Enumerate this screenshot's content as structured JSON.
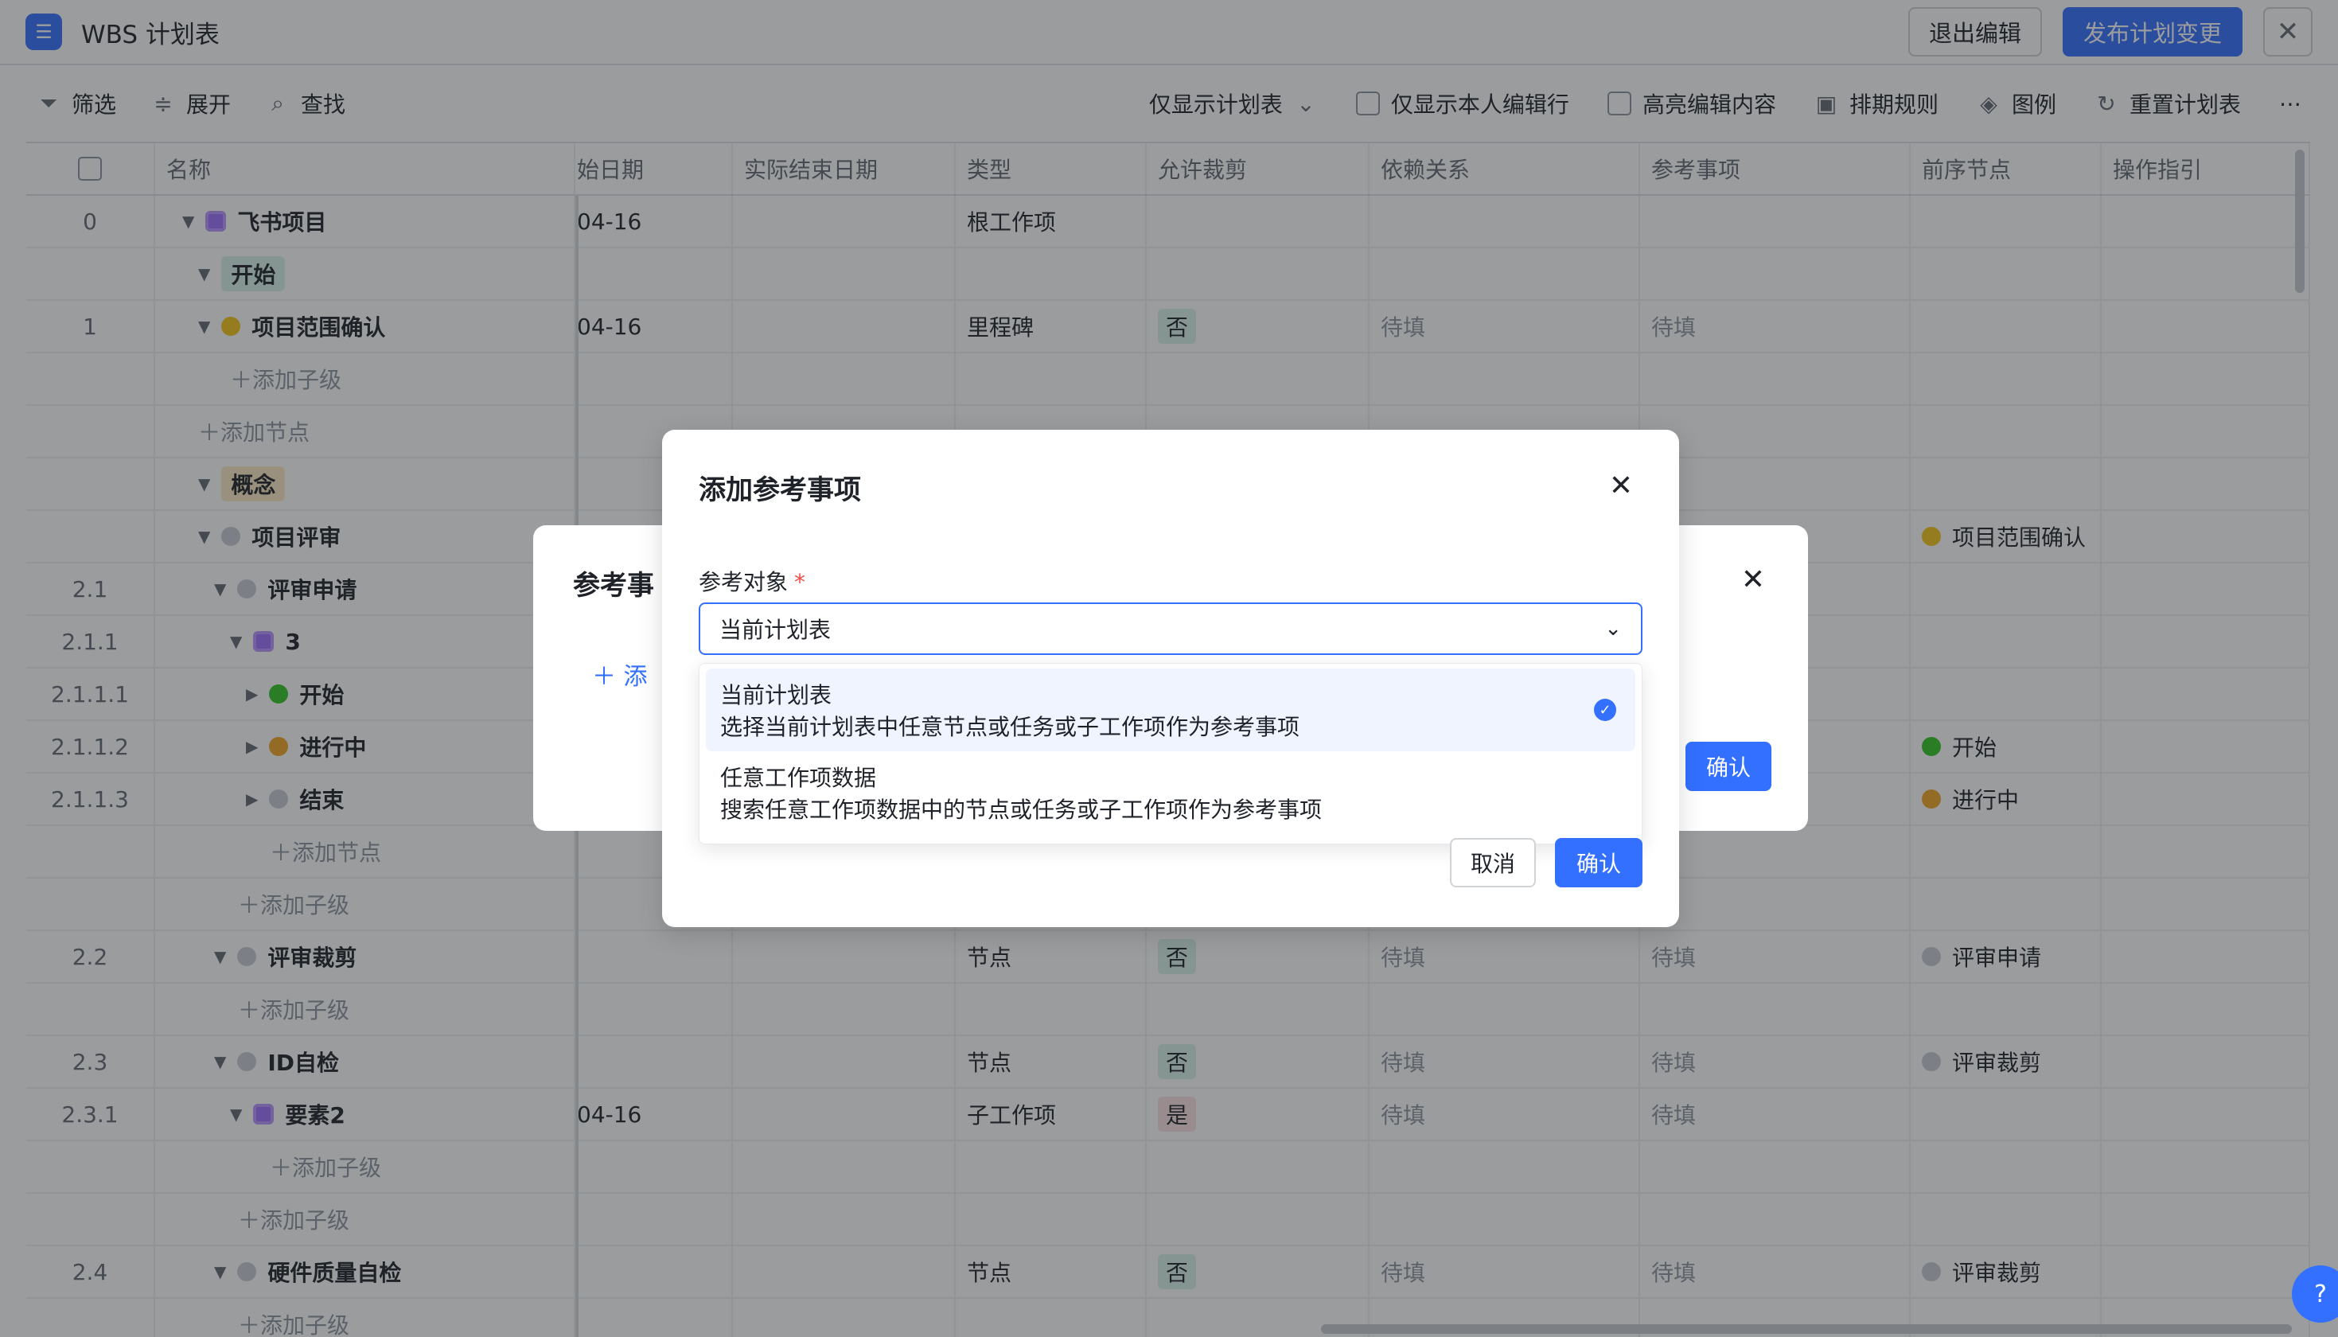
{
  "header": {
    "title": "WBS 计划表",
    "exit_edit": "退出编辑",
    "publish": "发布计划变更"
  },
  "toolbar": {
    "filter": "筛选",
    "expand": "展开",
    "find": "查找",
    "view_select": "仅显示计划表",
    "only_mine": "仅显示本人编辑行",
    "highlight": "高亮编辑内容",
    "schedule_rules": "排期规则",
    "legend": "图例",
    "reset": "重置计划表"
  },
  "table": {
    "headers": [
      "名称",
      "始日期",
      "实际结束日期",
      "类型",
      "允许裁剪",
      "依赖关系",
      "参考事项",
      "前序节点",
      "操作指引"
    ],
    "rows": [
      {
        "num": "0",
        "name": "飞书项目",
        "date": "04-16",
        "type": "根工作项",
        "cut": "",
        "dep": "",
        "ref": "",
        "prev": ""
      },
      {
        "num": "",
        "name": "开始",
        "date": "",
        "type": "",
        "cut": "",
        "dep": "",
        "ref": "",
        "prev": ""
      },
      {
        "num": "1",
        "name": "项目范围确认",
        "date": "04-16",
        "type": "里程碑",
        "cut": "否",
        "dep": "待填",
        "ref": "待填",
        "prev": ""
      },
      {
        "num": "",
        "name": "添加子级",
        "date": "",
        "type": "",
        "cut": "",
        "dep": "",
        "ref": "",
        "prev": ""
      },
      {
        "num": "",
        "name": "添加节点",
        "date": "",
        "type": "",
        "cut": "",
        "dep": "",
        "ref": "",
        "prev": ""
      },
      {
        "num": "",
        "name": "概念",
        "date": "",
        "type": "",
        "cut": "",
        "dep": "",
        "ref": "",
        "prev": ""
      },
      {
        "num": "",
        "name": "项目评审",
        "date": "",
        "type": "",
        "cut": "",
        "dep": "",
        "ref": "",
        "prev": "项目范围确认"
      },
      {
        "num": "2.1",
        "name": "评审申请",
        "date": "",
        "type": "",
        "cut": "",
        "dep": "",
        "ref": "",
        "prev": ""
      },
      {
        "num": "2.1.1",
        "name": "3",
        "date": "",
        "type": "",
        "cut": "",
        "dep": "",
        "ref": "",
        "prev": ""
      },
      {
        "num": "2.1.1.1",
        "name": "开始",
        "date": "",
        "type": "",
        "cut": "",
        "dep": "",
        "ref": "",
        "prev": ""
      },
      {
        "num": "2.1.1.2",
        "name": "进行中",
        "date": "",
        "type": "",
        "cut": "",
        "dep": "",
        "ref": "",
        "prev": "开始"
      },
      {
        "num": "2.1.1.3",
        "name": "结束",
        "date": "",
        "type": "",
        "cut": "",
        "dep": "",
        "ref": "",
        "prev": "进行中"
      },
      {
        "num": "",
        "name": "添加节点",
        "date": "",
        "type": "",
        "cut": "",
        "dep": "",
        "ref": "",
        "prev": ""
      },
      {
        "num": "",
        "name": "添加子级",
        "date": "",
        "type": "",
        "cut": "",
        "dep": "",
        "ref": "",
        "prev": ""
      },
      {
        "num": "2.2",
        "name": "评审裁剪",
        "date": "",
        "type": "节点",
        "cut": "否",
        "dep": "待填",
        "ref": "待填",
        "prev": "评审申请"
      },
      {
        "num": "",
        "name": "添加子级",
        "date": "",
        "type": "",
        "cut": "",
        "dep": "",
        "ref": "",
        "prev": ""
      },
      {
        "num": "2.3",
        "name": "ID自检",
        "date": "",
        "type": "节点",
        "cut": "否",
        "dep": "待填",
        "ref": "待填",
        "prev": "评审裁剪"
      },
      {
        "num": "2.3.1",
        "name": "要素2",
        "date": "04-16",
        "type": "子工作项",
        "cut": "是",
        "dep": "待填",
        "ref": "待填",
        "prev": ""
      },
      {
        "num": "",
        "name": "添加子级",
        "date": "",
        "type": "",
        "cut": "",
        "dep": "",
        "ref": "",
        "prev": ""
      },
      {
        "num": "",
        "name": "添加子级",
        "date": "",
        "type": "",
        "cut": "",
        "dep": "",
        "ref": "",
        "prev": ""
      },
      {
        "num": "2.4",
        "name": "硬件质量自检",
        "date": "",
        "type": "节点",
        "cut": "否",
        "dep": "待填",
        "ref": "待填",
        "prev": "评审裁剪"
      },
      {
        "num": "",
        "name": "添加子级",
        "date": "",
        "type": "",
        "cut": "",
        "dep": "",
        "ref": "",
        "prev": ""
      }
    ]
  },
  "back_dialog": {
    "title": "参考事",
    "add": "添",
    "confirm": "确认"
  },
  "dialog": {
    "title": "添加参考事项",
    "field_label": "参考对象",
    "required_mark": "*",
    "selected_value": "当前计划表",
    "options": [
      {
        "title": "当前计划表",
        "desc": "选择当前计划表中任意节点或任务或子工作项作为参考事项"
      },
      {
        "title": "任意工作项数据",
        "desc": "搜索任意工作项数据中的节点或任务或子工作项作为参考事项"
      }
    ],
    "cancel": "取消",
    "confirm": "确认"
  },
  "colors": {
    "primary": "#3370ff",
    "overlay": "rgba(31,35,41,0.45)",
    "tag_green": "#d9f3ea",
    "tag_red": "#fde2e2"
  }
}
